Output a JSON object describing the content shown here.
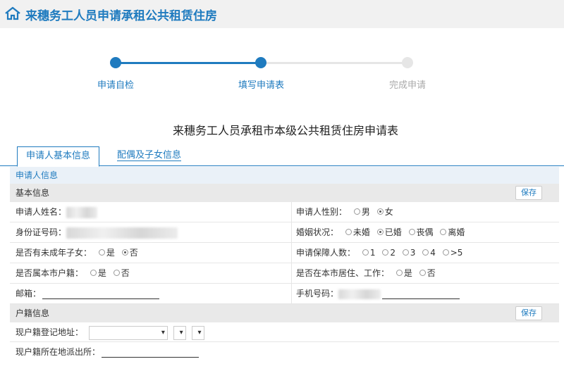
{
  "header": {
    "title": "来穗务工人员申请承租公共租赁住房",
    "icon": "home-icon"
  },
  "steps": [
    {
      "label": "申请自检",
      "state": "done"
    },
    {
      "label": "填写申请表",
      "state": "current"
    },
    {
      "label": "完成申请",
      "state": "pending"
    }
  ],
  "form_title": "来穗务工人员承租市本级公共租赁住房申请表",
  "tabs": [
    {
      "label": "申请人基本信息",
      "active": true
    },
    {
      "label": "配偶及子女信息",
      "active": false
    }
  ],
  "panel_title": "申请人信息",
  "sections": {
    "basic": {
      "title": "基本信息",
      "save": "保存",
      "name_label": "申请人姓名：",
      "gender_label": "申请人性别：",
      "gender_options": [
        "男",
        "女"
      ],
      "gender_selected": "女",
      "id_label": "身份证号码：",
      "marital_label": "婚姻状况：",
      "marital_options": [
        "未婚",
        "已婚",
        "丧偶",
        "离婚"
      ],
      "marital_selected": "已婚",
      "minor_label": "是否有未成年子女：",
      "minor_options": [
        "是",
        "否"
      ],
      "minor_selected": "否",
      "count_label": "申请保障人数：",
      "count_options": [
        "1",
        "2",
        "3",
        "4",
        ">5"
      ],
      "huji_label": "是否属本市户籍：",
      "huji_options": [
        "是",
        "否"
      ],
      "live_label": "是否在本市居住、工作：",
      "live_options": [
        "是",
        "否"
      ],
      "email_label": "邮箱：",
      "phone_label": "手机号码："
    },
    "household": {
      "title": "户籍信息",
      "save": "保存",
      "addr_label": "现户籍登记地址：",
      "police_label": "现户籍所在地派出所："
    }
  },
  "colors": {
    "accent": "#1f7bbf",
    "inactive": "#e6e6e6"
  }
}
